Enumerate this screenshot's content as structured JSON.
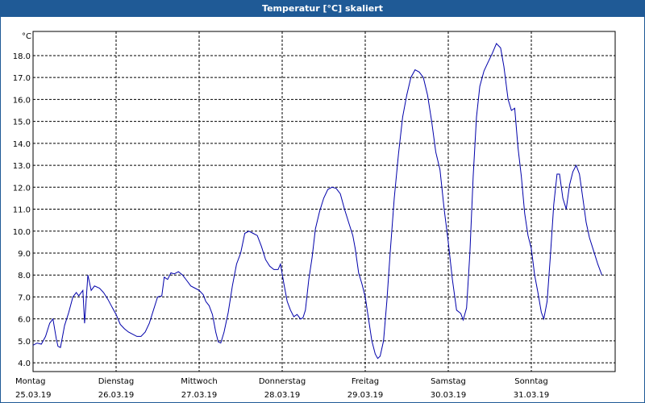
{
  "window": {
    "title": "Temperatur [°C] skaliert"
  },
  "colors": {
    "titlebar": "#1f5a96",
    "line": "#0000aa",
    "grid": "#000000"
  },
  "chart_data": {
    "type": "line",
    "title": "Temperatur [°C] skaliert",
    "ylabel": "°C",
    "xlabel": "",
    "ylim": [
      3.6,
      19.1
    ],
    "grid": true,
    "y_ticks": [
      "4.0",
      "5.0",
      "6.0",
      "7.0",
      "8.0",
      "9.0",
      "10.0",
      "11.0",
      "12.0",
      "13.0",
      "14.0",
      "15.0",
      "16.0",
      "17.0",
      "18.0"
    ],
    "x_ticks": [
      {
        "day": "Montag",
        "date": "25.03.19"
      },
      {
        "day": "Dienstag",
        "date": "26.03.19"
      },
      {
        "day": "Mittwoch",
        "date": "27.03.19"
      },
      {
        "day": "Donnerstag",
        "date": "28.03.19"
      },
      {
        "day": "Freitag",
        "date": "29.03.19"
      },
      {
        "day": "Samstag",
        "date": "30.03.19"
      },
      {
        "day": "Sonntag",
        "date": "31.03.19"
      }
    ],
    "x_unit": "days",
    "xlim": [
      0,
      7.02
    ],
    "series": [
      {
        "values": [
          [
            0.0,
            4.8
          ],
          [
            0.05,
            4.9
          ],
          [
            0.1,
            4.85
          ],
          [
            0.15,
            5.2
          ],
          [
            0.2,
            5.8
          ],
          [
            0.24,
            6.0
          ],
          [
            0.28,
            5.1
          ],
          [
            0.3,
            4.75
          ],
          [
            0.33,
            4.7
          ],
          [
            0.38,
            5.7
          ],
          [
            0.43,
            6.3
          ],
          [
            0.48,
            7.0
          ],
          [
            0.52,
            7.2
          ],
          [
            0.55,
            7.05
          ],
          [
            0.6,
            7.3
          ],
          [
            0.62,
            5.8
          ],
          [
            0.66,
            8.0
          ],
          [
            0.7,
            7.3
          ],
          [
            0.74,
            7.5
          ],
          [
            0.8,
            7.4
          ],
          [
            0.85,
            7.2
          ],
          [
            0.9,
            6.9
          ],
          [
            0.95,
            6.55
          ],
          [
            1.0,
            6.2
          ],
          [
            1.05,
            5.75
          ],
          [
            1.1,
            5.55
          ],
          [
            1.15,
            5.4
          ],
          [
            1.2,
            5.3
          ],
          [
            1.25,
            5.2
          ],
          [
            1.3,
            5.2
          ],
          [
            1.35,
            5.4
          ],
          [
            1.4,
            5.8
          ],
          [
            1.45,
            6.4
          ],
          [
            1.5,
            7.0
          ],
          [
            1.55,
            7.05
          ],
          [
            1.58,
            7.9
          ],
          [
            1.62,
            7.8
          ],
          [
            1.66,
            8.1
          ],
          [
            1.7,
            8.05
          ],
          [
            1.75,
            8.15
          ],
          [
            1.8,
            8.0
          ],
          [
            1.85,
            7.75
          ],
          [
            1.9,
            7.5
          ],
          [
            1.95,
            7.4
          ],
          [
            2.0,
            7.3
          ],
          [
            2.05,
            7.1
          ],
          [
            2.08,
            6.8
          ],
          [
            2.12,
            6.6
          ],
          [
            2.16,
            6.2
          ],
          [
            2.2,
            5.4
          ],
          [
            2.23,
            4.95
          ],
          [
            2.26,
            4.9
          ],
          [
            2.3,
            5.4
          ],
          [
            2.35,
            6.3
          ],
          [
            2.4,
            7.5
          ],
          [
            2.45,
            8.5
          ],
          [
            2.5,
            9.0
          ],
          [
            2.55,
            9.9
          ],
          [
            2.6,
            10.0
          ],
          [
            2.65,
            9.9
          ],
          [
            2.7,
            9.8
          ],
          [
            2.75,
            9.3
          ],
          [
            2.8,
            8.7
          ],
          [
            2.85,
            8.4
          ],
          [
            2.9,
            8.25
          ],
          [
            2.95,
            8.25
          ],
          [
            2.98,
            8.5
          ],
          [
            3.02,
            7.6
          ],
          [
            3.06,
            6.8
          ],
          [
            3.1,
            6.4
          ],
          [
            3.14,
            6.1
          ],
          [
            3.18,
            6.2
          ],
          [
            3.22,
            6.0
          ],
          [
            3.25,
            6.05
          ],
          [
            3.28,
            6.4
          ],
          [
            3.32,
            7.8
          ],
          [
            3.36,
            8.8
          ],
          [
            3.4,
            10.1
          ],
          [
            3.45,
            10.9
          ],
          [
            3.5,
            11.5
          ],
          [
            3.55,
            11.9
          ],
          [
            3.6,
            12.0
          ],
          [
            3.65,
            11.95
          ],
          [
            3.7,
            11.7
          ],
          [
            3.75,
            11.0
          ],
          [
            3.8,
            10.4
          ],
          [
            3.85,
            9.8
          ],
          [
            3.88,
            9.2
          ],
          [
            3.92,
            8.1
          ],
          [
            3.96,
            7.6
          ],
          [
            4.0,
            7.0
          ],
          [
            4.04,
            6.0
          ],
          [
            4.08,
            5.0
          ],
          [
            4.12,
            4.4
          ],
          [
            4.15,
            4.2
          ],
          [
            4.18,
            4.3
          ],
          [
            4.22,
            5.0
          ],
          [
            4.26,
            6.8
          ],
          [
            4.3,
            9.0
          ],
          [
            4.35,
            11.5
          ],
          [
            4.4,
            13.5
          ],
          [
            4.45,
            15.2
          ],
          [
            4.5,
            16.2
          ],
          [
            4.55,
            17.0
          ],
          [
            4.6,
            17.35
          ],
          [
            4.65,
            17.25
          ],
          [
            4.7,
            17.0
          ],
          [
            4.75,
            16.2
          ],
          [
            4.8,
            15.0
          ],
          [
            4.85,
            13.6
          ],
          [
            4.9,
            12.8
          ],
          [
            4.95,
            11.0
          ],
          [
            5.0,
            9.5
          ],
          [
            5.05,
            7.8
          ],
          [
            5.1,
            6.4
          ],
          [
            5.15,
            6.25
          ],
          [
            5.18,
            5.95
          ],
          [
            5.22,
            6.5
          ],
          [
            5.26,
            9.0
          ],
          [
            5.3,
            12.5
          ],
          [
            5.34,
            15.2
          ],
          [
            5.38,
            16.6
          ],
          [
            5.43,
            17.3
          ],
          [
            5.48,
            17.7
          ],
          [
            5.53,
            18.1
          ],
          [
            5.58,
            18.55
          ],
          [
            5.63,
            18.35
          ],
          [
            5.67,
            17.5
          ],
          [
            5.72,
            16.0
          ],
          [
            5.76,
            15.5
          ],
          [
            5.8,
            15.6
          ],
          [
            5.84,
            13.8
          ],
          [
            5.88,
            12.5
          ],
          [
            5.92,
            10.8
          ],
          [
            5.96,
            9.8
          ],
          [
            6.0,
            9.2
          ],
          [
            6.04,
            8.0
          ],
          [
            6.08,
            7.2
          ],
          [
            6.12,
            6.3
          ],
          [
            6.15,
            6.0
          ],
          [
            6.19,
            6.8
          ],
          [
            6.23,
            8.9
          ],
          [
            6.27,
            11.2
          ],
          [
            6.31,
            12.6
          ],
          [
            6.34,
            12.6
          ],
          [
            6.38,
            11.5
          ],
          [
            6.42,
            11.0
          ],
          [
            6.46,
            12.1
          ],
          [
            6.5,
            12.7
          ],
          [
            6.54,
            13.0
          ],
          [
            6.58,
            12.6
          ],
          [
            6.62,
            11.5
          ],
          [
            6.66,
            10.4
          ],
          [
            6.7,
            9.7
          ],
          [
            6.75,
            9.1
          ],
          [
            6.8,
            8.5
          ],
          [
            6.85,
            8.0
          ]
        ]
      }
    ]
  }
}
